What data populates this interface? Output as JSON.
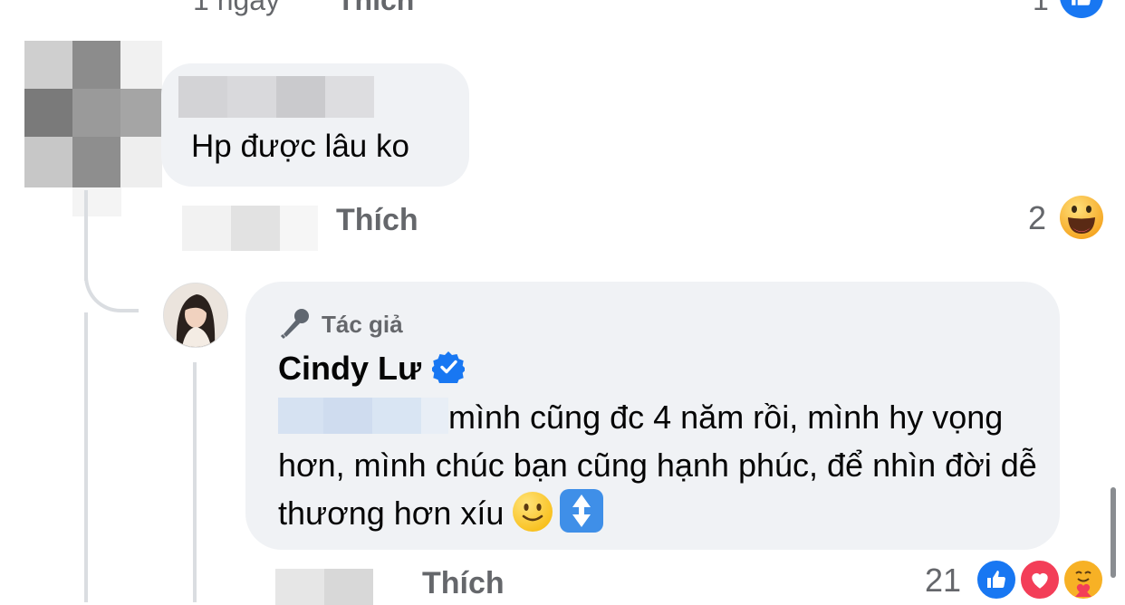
{
  "top_row": {
    "time": "1 ngày",
    "like_label": "Thích",
    "reaction_count": "1"
  },
  "comment1": {
    "text": "Hp được lâu ko",
    "like_label": "Thích",
    "reaction_count": "2"
  },
  "reply": {
    "author_badge": "Tác giả",
    "author_name": "Cindy Lư",
    "message": "mình cũng đc 4 năm rồi, mình hy vọng hơn, mình chúc bạn cũng hạnh phúc, để nhìn đời dễ thương hơn xíu",
    "like_label": "Thích",
    "reaction_count": "21"
  },
  "icons": {
    "like": "like-icon",
    "laugh": "laugh-icon",
    "love": "love-icon",
    "care": "care-icon",
    "microphone": "microphone-icon",
    "verified": "verified-badge-icon",
    "smile_emoji": "slightly-smiling-emoji",
    "arrows_emoji": "up-down-arrow-emoji"
  },
  "colors": {
    "accent": "#1877f2",
    "bubble": "#f0f2f5",
    "muted_text": "#65676b",
    "love": "#f33e58",
    "reaction_yellow": "#f7b125"
  }
}
